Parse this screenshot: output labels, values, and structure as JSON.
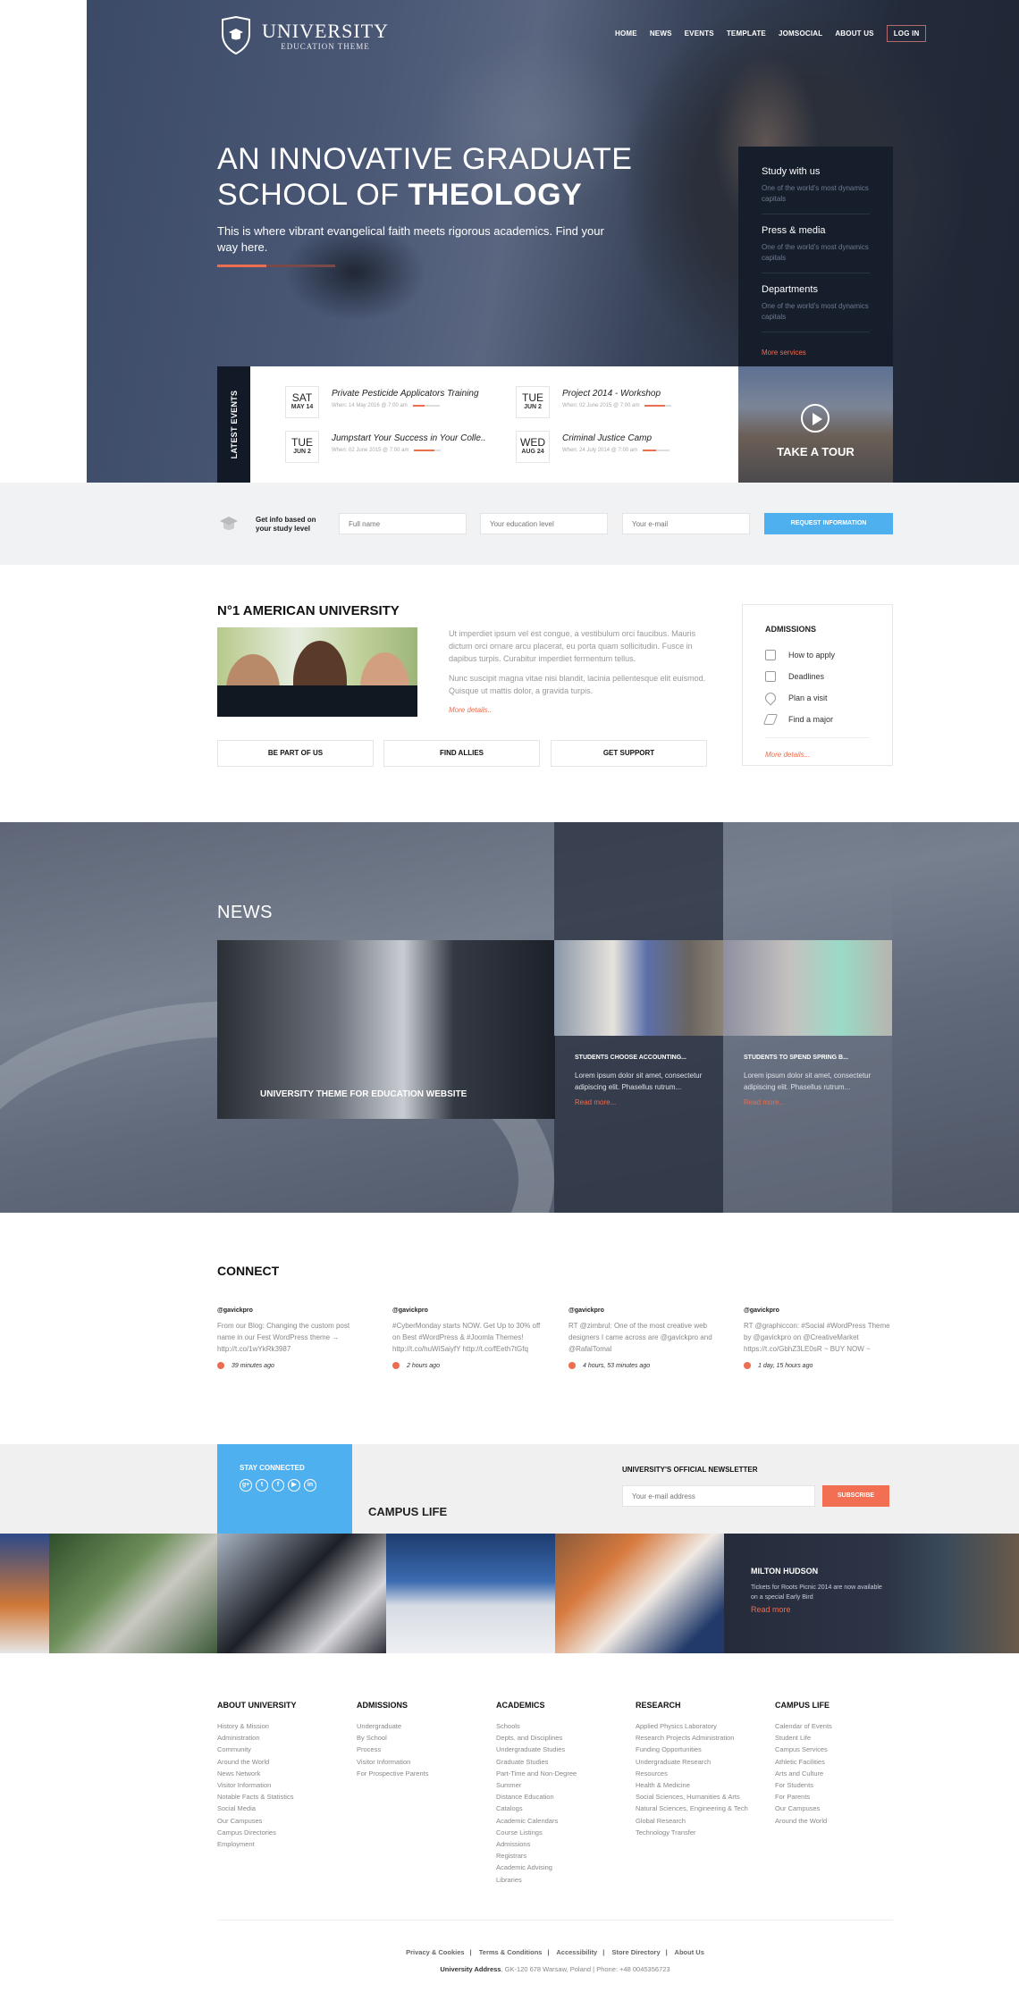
{
  "header": {
    "logo_name": "UNIVERSITY",
    "logo_sub": "EDUCATION THEME",
    "nav": [
      "HOME",
      "NEWS",
      "EVENTS",
      "TEMPLATE",
      "JOMSOCIAL",
      "ABOUT US"
    ],
    "login": "LOG IN"
  },
  "hero": {
    "title_line1": "AN INNOVATIVE GRADUATE",
    "title_line2_light": "SCHOOL OF ",
    "title_line2_bold": "THEOLOGY",
    "subtitle": "This is where vibrant evangelical faith meets rigorous academics. Find your way here.",
    "services": [
      {
        "title": "Study with us",
        "desc": "One of the world's most dynamics capitals"
      },
      {
        "title": "Press & media",
        "desc": "One of the world's most dynamics capitals"
      },
      {
        "title": "Departments",
        "desc": "One of the world's most dynamics capitals"
      }
    ],
    "more_services": "More services"
  },
  "events": {
    "label": "LATEST EVENTS",
    "items": [
      {
        "day": "SAT",
        "date": "MAY 14",
        "title": "Private Pesticide Applicators Training",
        "when": "When: 14 May 2016 @ 7:00 am",
        "progress": 0.45
      },
      {
        "day": "TUE",
        "date": "JUN 2",
        "title": "Project 2014 - Workshop",
        "when": "When: 02 June 2015 @ 7:00 am",
        "progress": 0.75
      },
      {
        "day": "TUE",
        "date": "JUN 2",
        "title": "Jumpstart Your Success in Your Colle..",
        "when": "When: 02 June 2015 @ 7:00 am",
        "progress": 0.75
      },
      {
        "day": "WED",
        "date": "AUG 24",
        "title": "Criminal Justice Camp",
        "when": "When: 24 July 2014 @ 7:00 am",
        "progress": 0.5
      }
    ],
    "tour": "TAKE A TOUR"
  },
  "info": {
    "label": "Get info based on your study level",
    "fullname_placeholder": "Full name",
    "education_placeholder": "Your education level",
    "email_placeholder": "Your e-mail",
    "button": "REQUEST INFORMATION"
  },
  "about": {
    "title": "N°1 AMERICAN UNIVERSITY",
    "p1": "Ut imperdiet ipsum vel est congue, a vestibulum orci faucibus. Mauris dictum orci ornare arcu placerat, eu porta quam sollicitudin. Fusce in dapibus turpis. Curabitur imperdiet fermentum tellus.",
    "p2": "Nunc suscipit magna vitae nisi blandit, lacinia pellentesque elit euismod. Quisque ut mattis dolor, a gravida turpis.",
    "more": "More details..",
    "buttons": [
      "BE PART OF US",
      "FIND ALLIES",
      "GET SUPPORT"
    ]
  },
  "admissions": {
    "title": "ADMISSIONS",
    "items": [
      {
        "icon": "document-icon",
        "label": "How to apply"
      },
      {
        "icon": "calendar-icon",
        "label": "Deadlines"
      },
      {
        "icon": "map-pin-icon",
        "label": "Plan a visit"
      },
      {
        "icon": "graduation-cap-icon",
        "label": "Find a major"
      }
    ],
    "more": "More details..."
  },
  "news": {
    "title": "NEWS",
    "featured": "UNIVERSITY THEME FOR EDUCATION WEBSITE",
    "items": [
      {
        "title": "STUDENTS CHOOSE ACCOUNTING...",
        "text": "Lorem ipsum dolor sit amet, consectetur adipiscing elit. Phasellus rutrum...",
        "more": "Read more..."
      },
      {
        "title": "STUDENTS TO SPEND SPRING B...",
        "text": "Lorem ipsum dolor sit amet, consectetur adipiscing elit. Phasellus rutrum...",
        "more": "Read more..."
      }
    ]
  },
  "connect": {
    "title": "CONNECT",
    "tweets": [
      {
        "user": "@gavickpro",
        "text": "From our Blog: Changing the custom post name in our Fest WordPress theme → http://t.co/1wYkRk3987",
        "time": "39 minutes ago"
      },
      {
        "user": "@gavickpro",
        "text": "#CyberMonday starts NOW. Get Up to 30% off on Best #WordPress & #Joomla Themes! http://t.co/huWiSaiyfY http://t.co/fEeth7tGfq",
        "time": "2 hours ago"
      },
      {
        "user": "@gavickpro",
        "text": "RT @zimbrul: One of the most creative web designers I came across are @gavickpro and @RafalTomal",
        "time": "4 hours, 53 minutes ago"
      },
      {
        "user": "@gavickpro",
        "text": "RT @graphiccon: #Social #WordPress Theme by @gavickpro on @CreativeMarket https://t.co/GbhZ3LE0sR ~ BUY NOW ~",
        "time": "1 day, 15 hours ago"
      }
    ]
  },
  "stay": {
    "title": "STAY CONNECTED",
    "social": [
      {
        "icon": "google-plus-icon",
        "glyph": "g+"
      },
      {
        "icon": "twitter-icon",
        "glyph": "t"
      },
      {
        "icon": "facebook-icon",
        "glyph": "f"
      },
      {
        "icon": "youtube-icon",
        "glyph": "▶"
      },
      {
        "icon": "linkedin-icon",
        "glyph": "in"
      }
    ],
    "campus_title": "CAMPUS LIFE",
    "newsletter_title": "UNIVERSITY'S OFFICIAL NEWSLETTER",
    "newsletter_placeholder": "Your e-mail address",
    "subscribe": "SUBSCRIBE"
  },
  "campus": {
    "person": "MILTON HUDSON",
    "text": "Tickets for Roots Picnic 2014 are now available on a special Early Bird",
    "more": "Read more"
  },
  "footer": {
    "columns": [
      {
        "title": "ABOUT UNIVERSITY",
        "links": [
          "History & Mission",
          "Administration",
          "Community",
          "Around the World",
          "News Network",
          "Visitor Information",
          "Notable Facts & Statistics",
          "Social Media",
          "Our Campuses",
          "Campus Directories",
          "Employment"
        ]
      },
      {
        "title": "ADMISSIONS",
        "links": [
          "Undergraduate",
          "By School",
          "Process",
          "Visitor Information",
          "For Prospective Parents"
        ]
      },
      {
        "title": "ACADEMICS",
        "links": [
          "Schools",
          "Depts. and Disciplines",
          "Undergraduate Studies",
          "Graduate Studies",
          "Part-Time and Non-Degree",
          "Summer",
          "Distance Education",
          "Catalogs",
          "Academic Calendars",
          "Course Listings",
          "Admissions",
          "Registrars",
          "Academic Advising",
          "Libraries"
        ]
      },
      {
        "title": "RESEARCH",
        "links": [
          "Applied Physics Laboratory",
          "Research Projects Administration",
          "Funding Opportunities",
          "Undergraduate Research",
          "Resources",
          "Health & Medicine",
          "Social Sciences, Humanities & Arts",
          "Natural Sciences, Engineering & Tech",
          "Global Research",
          "Technology Transfer"
        ]
      },
      {
        "title": "CAMPUS LIFE",
        "links": [
          "Calendar of Events",
          "Student Life",
          "Campus Services",
          "Athletic Facilities",
          "Arts and Culture",
          "For Students",
          "For Parents",
          "Our Campuses",
          "Around the World"
        ]
      }
    ],
    "bottom_links": [
      "Privacy & Cookies",
      "Terms & Conditions",
      "Accessibility",
      "Store Directory",
      "About Us"
    ],
    "address_label": "University Address",
    "address": ", GK-120 678 Warsaw, Poland | Phone: +48 0045356723"
  },
  "colors": {
    "accent": "#ec6d4f",
    "blue": "#4fb0f0",
    "dark": "#161d2b"
  }
}
